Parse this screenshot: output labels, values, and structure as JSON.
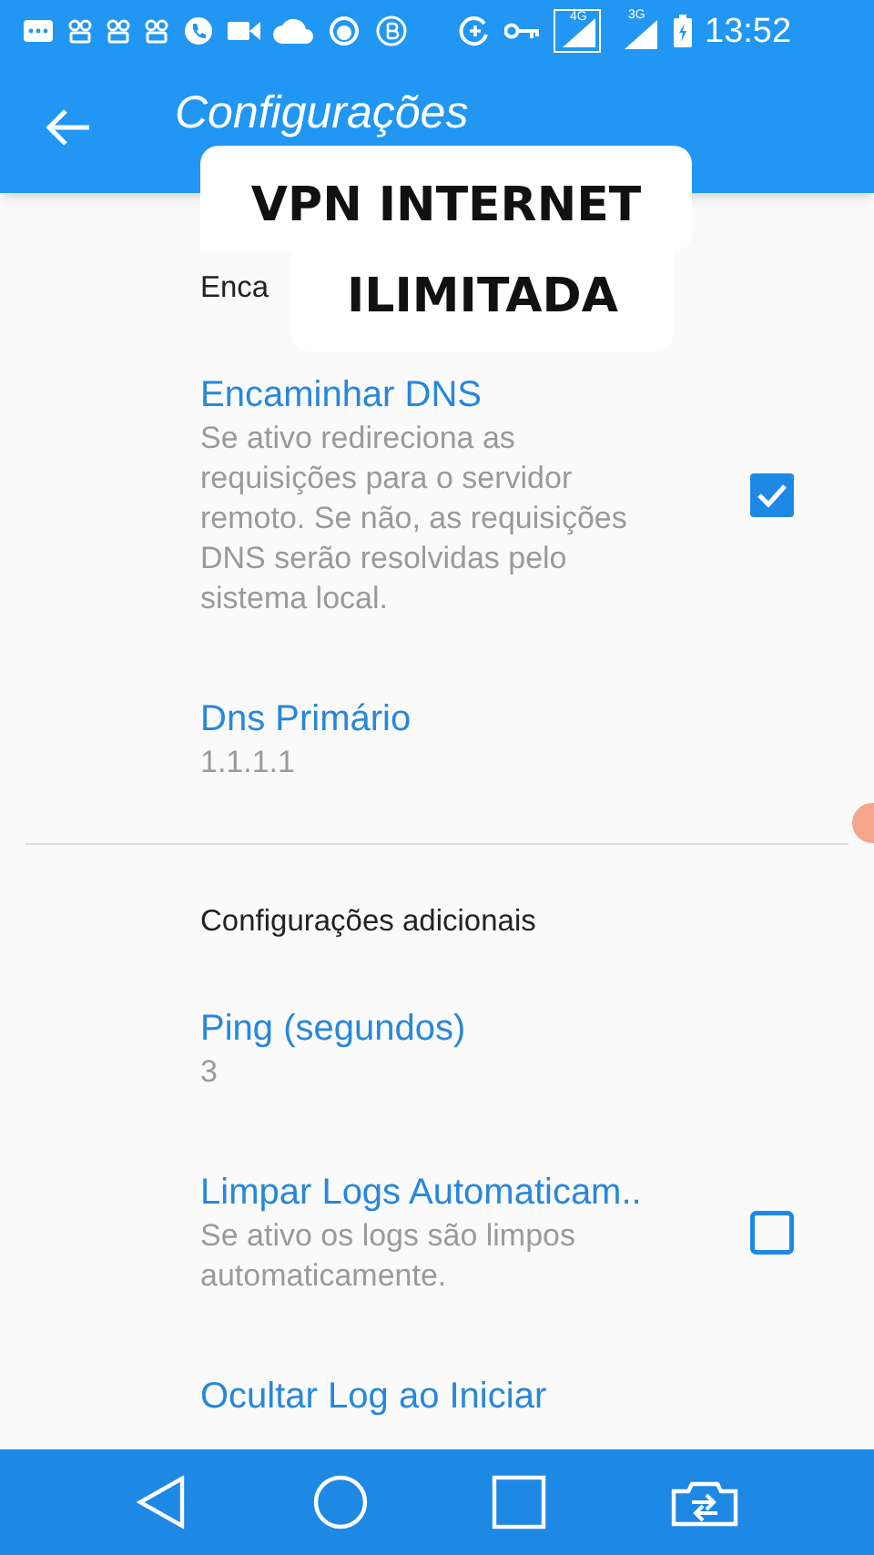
{
  "status_bar": {
    "network_labels": [
      "4G",
      "3G"
    ],
    "time": "13:52"
  },
  "app_bar": {
    "title": "Configurações"
  },
  "sections": [
    {
      "header": "Enca",
      "items": [
        {
          "kind": "checkbox",
          "title": "Encaminhar DNS",
          "summary": "Se ativo redireciona as requisições para o servidor remoto. Se não, as requisições DNS serão resolvidas pelo sistema local.",
          "checked": true
        },
        {
          "kind": "text",
          "title": "Dns Primário",
          "summary": "1.1.1.1"
        }
      ]
    },
    {
      "header": "Configurações adicionais",
      "items": [
        {
          "kind": "text",
          "title": "Ping (segundos)",
          "summary": "3"
        },
        {
          "kind": "checkbox",
          "title": "Limpar Logs Automaticam..",
          "summary": "Se ativo os logs são limpos automaticamente.",
          "checked": false
        },
        {
          "kind": "text",
          "title": "Ocultar Log ao Iniciar"
        }
      ]
    }
  ],
  "overlay_caption": [
    "VPN INTERNET",
    "ILIMITADA"
  ]
}
